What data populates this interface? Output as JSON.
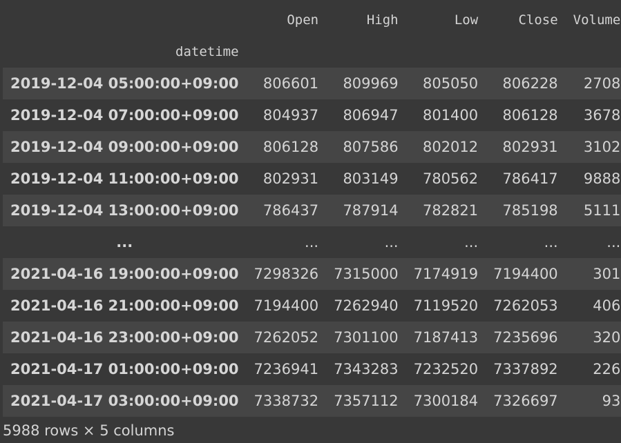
{
  "table": {
    "columns": [
      "Open",
      "High",
      "Low",
      "Close",
      "Volume"
    ],
    "index_name": "datetime",
    "rows": [
      {
        "index": "2019-12-04 05:00:00+09:00",
        "cells": [
          "806601",
          "809969",
          "805050",
          "806228",
          "2708"
        ]
      },
      {
        "index": "2019-12-04 07:00:00+09:00",
        "cells": [
          "804937",
          "806947",
          "801400",
          "806128",
          "3678"
        ]
      },
      {
        "index": "2019-12-04 09:00:00+09:00",
        "cells": [
          "806128",
          "807586",
          "802012",
          "802931",
          "3102"
        ]
      },
      {
        "index": "2019-12-04 11:00:00+09:00",
        "cells": [
          "802931",
          "803149",
          "780562",
          "786417",
          "9888"
        ]
      },
      {
        "index": "2019-12-04 13:00:00+09:00",
        "cells": [
          "786437",
          "787914",
          "782821",
          "785198",
          "5111"
        ]
      },
      {
        "index": "...",
        "cells": [
          "...",
          "...",
          "...",
          "...",
          "..."
        ]
      },
      {
        "index": "2021-04-16 19:00:00+09:00",
        "cells": [
          "7298326",
          "7315000",
          "7174919",
          "7194400",
          "301"
        ]
      },
      {
        "index": "2021-04-16 21:00:00+09:00",
        "cells": [
          "7194400",
          "7262940",
          "7119520",
          "7262053",
          "406"
        ]
      },
      {
        "index": "2021-04-16 23:00:00+09:00",
        "cells": [
          "7262052",
          "7301100",
          "7187413",
          "7235696",
          "320"
        ]
      },
      {
        "index": "2021-04-17 01:00:00+09:00",
        "cells": [
          "7236941",
          "7343283",
          "7232520",
          "7337892",
          "226"
        ]
      },
      {
        "index": "2021-04-17 03:00:00+09:00",
        "cells": [
          "7338732",
          "7357112",
          "7300184",
          "7326697",
          "93"
        ]
      }
    ]
  },
  "footer": {
    "summary": "5988 rows × 5 columns"
  },
  "colors": {
    "background": "#383838",
    "row_alt": "#454545",
    "text": "#d4d4d4"
  }
}
